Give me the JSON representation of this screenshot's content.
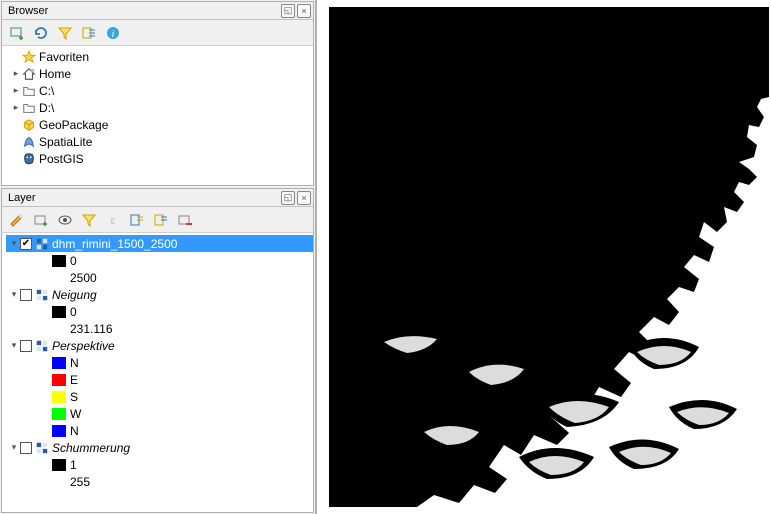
{
  "browser": {
    "title": "Browser",
    "items": [
      {
        "label": "Favoriten",
        "icon": "star",
        "arrow": "none"
      },
      {
        "label": "Home",
        "icon": "home",
        "arrow": "right"
      },
      {
        "label": "C:\\",
        "icon": "folder",
        "arrow": "right"
      },
      {
        "label": "D:\\",
        "icon": "folder",
        "arrow": "right"
      },
      {
        "label": "GeoPackage",
        "icon": "geopackage",
        "arrow": "none"
      },
      {
        "label": "SpatiaLite",
        "icon": "spatialite",
        "arrow": "none"
      },
      {
        "label": "PostGIS",
        "icon": "postgis",
        "arrow": "none"
      }
    ]
  },
  "layer_panel": {
    "title": "Layer",
    "layers": [
      {
        "name": "dhm_rimini_1500_2500",
        "icon": "raster",
        "checked": true,
        "selected": true,
        "expanded": true,
        "legend": [
          {
            "color": "#000000",
            "label": "0"
          },
          {
            "color": null,
            "label": "2500"
          }
        ]
      },
      {
        "name": "Neigung",
        "icon": "raster",
        "checked": false,
        "italic": true,
        "expanded": true,
        "legend": [
          {
            "color": "#000000",
            "label": "0"
          },
          {
            "color": null,
            "label": "231.116"
          }
        ]
      },
      {
        "name": "Perspektive",
        "icon": "raster",
        "checked": false,
        "italic": true,
        "expanded": true,
        "legend": [
          {
            "color": "#0000ff",
            "label": "N"
          },
          {
            "color": "#ff0000",
            "label": "E"
          },
          {
            "color": "#ffff00",
            "label": "S"
          },
          {
            "color": "#00ff00",
            "label": "W"
          },
          {
            "color": "#0000ff",
            "label": "N"
          }
        ]
      },
      {
        "name": "Schummerung",
        "icon": "raster",
        "checked": false,
        "italic": true,
        "expanded": true,
        "legend": [
          {
            "color": "#000000",
            "label": "1"
          },
          {
            "color": null,
            "label": "255"
          }
        ]
      }
    ]
  },
  "toolbar_browser": [
    "add",
    "refresh",
    "filter",
    "collapse",
    "info"
  ],
  "toolbar_layer": [
    "style",
    "add",
    "visibility",
    "filter",
    "expression",
    "expand",
    "collapse",
    "remove"
  ]
}
